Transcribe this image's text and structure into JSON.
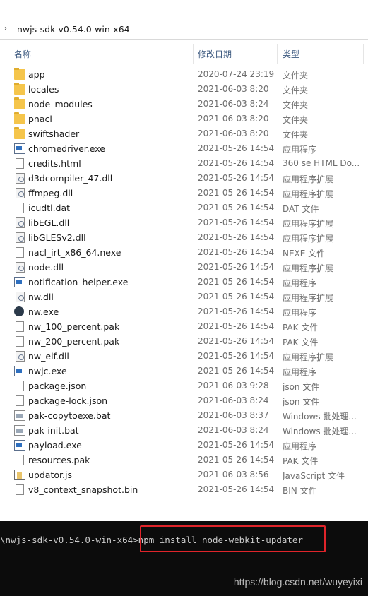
{
  "address": {
    "path": "nwjs-sdk-v0.54.0-win-x64"
  },
  "columns": {
    "name": "名称",
    "date": "修改日期",
    "type": "类型"
  },
  "files": [
    {
      "name": "app",
      "date": "2020-07-24 23:19",
      "type": "文件夹",
      "icon": "folder-icon"
    },
    {
      "name": "locales",
      "date": "2021-06-03 8:20",
      "type": "文件夹",
      "icon": "folder-icon"
    },
    {
      "name": "node_modules",
      "date": "2021-06-03 8:24",
      "type": "文件夹",
      "icon": "folder-icon"
    },
    {
      "name": "pnacl",
      "date": "2021-06-03 8:20",
      "type": "文件夹",
      "icon": "folder-icon"
    },
    {
      "name": "swiftshader",
      "date": "2021-06-03 8:20",
      "type": "文件夹",
      "icon": "folder-icon"
    },
    {
      "name": "chromedriver.exe",
      "date": "2021-05-26 14:54",
      "type": "应用程序",
      "icon": "exe-icon"
    },
    {
      "name": "credits.html",
      "date": "2021-05-26 14:54",
      "type": "360 se HTML Do...",
      "icon": "file-icon"
    },
    {
      "name": "d3dcompiler_47.dll",
      "date": "2021-05-26 14:54",
      "type": "应用程序扩展",
      "icon": "dll-icon"
    },
    {
      "name": "ffmpeg.dll",
      "date": "2021-05-26 14:54",
      "type": "应用程序扩展",
      "icon": "dll-icon"
    },
    {
      "name": "icudtl.dat",
      "date": "2021-05-26 14:54",
      "type": "DAT 文件",
      "icon": "file-icon"
    },
    {
      "name": "libEGL.dll",
      "date": "2021-05-26 14:54",
      "type": "应用程序扩展",
      "icon": "dll-icon"
    },
    {
      "name": "libGLESv2.dll",
      "date": "2021-05-26 14:54",
      "type": "应用程序扩展",
      "icon": "dll-icon"
    },
    {
      "name": "nacl_irt_x86_64.nexe",
      "date": "2021-05-26 14:54",
      "type": "NEXE 文件",
      "icon": "file-icon"
    },
    {
      "name": "node.dll",
      "date": "2021-05-26 14:54",
      "type": "应用程序扩展",
      "icon": "dll-icon"
    },
    {
      "name": "notification_helper.exe",
      "date": "2021-05-26 14:54",
      "type": "应用程序",
      "icon": "exe-icon"
    },
    {
      "name": "nw.dll",
      "date": "2021-05-26 14:54",
      "type": "应用程序扩展",
      "icon": "dll-icon"
    },
    {
      "name": "nw.exe",
      "date": "2021-05-26 14:54",
      "type": "应用程序",
      "icon": "nw-exe-icon"
    },
    {
      "name": "nw_100_percent.pak",
      "date": "2021-05-26 14:54",
      "type": "PAK 文件",
      "icon": "file-icon"
    },
    {
      "name": "nw_200_percent.pak",
      "date": "2021-05-26 14:54",
      "type": "PAK 文件",
      "icon": "file-icon"
    },
    {
      "name": "nw_elf.dll",
      "date": "2021-05-26 14:54",
      "type": "应用程序扩展",
      "icon": "dll-icon"
    },
    {
      "name": "nwjc.exe",
      "date": "2021-05-26 14:54",
      "type": "应用程序",
      "icon": "exe-icon"
    },
    {
      "name": "package.json",
      "date": "2021-06-03 9:28",
      "type": "json 文件",
      "icon": "file-icon"
    },
    {
      "name": "package-lock.json",
      "date": "2021-06-03 8:24",
      "type": "json 文件",
      "icon": "file-icon"
    },
    {
      "name": "pak-copytoexe.bat",
      "date": "2021-06-03 8:37",
      "type": "Windows 批处理...",
      "icon": "bat-icon"
    },
    {
      "name": "pak-init.bat",
      "date": "2021-06-03 8:24",
      "type": "Windows 批处理...",
      "icon": "bat-icon"
    },
    {
      "name": "payload.exe",
      "date": "2021-05-26 14:54",
      "type": "应用程序",
      "icon": "exe-icon"
    },
    {
      "name": "resources.pak",
      "date": "2021-05-26 14:54",
      "type": "PAK 文件",
      "icon": "file-icon"
    },
    {
      "name": "updator.js",
      "date": "2021-06-03 8:56",
      "type": "JavaScript 文件",
      "icon": "js-icon"
    },
    {
      "name": "v8_context_snapshot.bin",
      "date": "2021-05-26 14:54",
      "type": "BIN 文件",
      "icon": "file-icon"
    }
  ],
  "console": {
    "prompt": "\\nwjs-sdk-v0.54.0-win-x64>",
    "command": "npm install node-webkit-updater"
  },
  "watermark": "https://blog.csdn.net/wuyeyixi",
  "colors": {
    "folder": "#f5c54b",
    "highlight": "#e0242a",
    "console_bg": "#0c0c0c"
  }
}
